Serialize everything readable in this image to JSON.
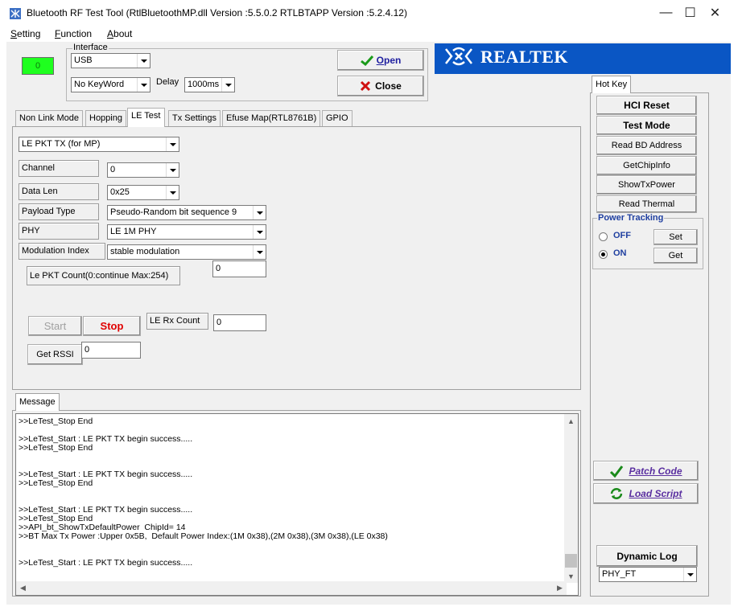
{
  "window": {
    "title": "Bluetooth RF Test Tool (RtlBluetoothMP.dll Version :5.5.0.2   RTLBTAPP Version :5.2.4.12)",
    "minimize": "—",
    "maximize": "☐",
    "close": "✕"
  },
  "menu": {
    "setting": "etting",
    "setting_key": "S",
    "function": "unction",
    "function_key": "F",
    "about": "bout",
    "about_key": "A"
  },
  "status_lamp": {
    "value": "0",
    "color": "#1fff1f"
  },
  "interface": {
    "legend": "Interface",
    "port": "USB",
    "keyword": "No KeyWord",
    "delay_label": "Delay",
    "delay_value": "1000ms"
  },
  "buttons": {
    "open": "Open",
    "open_key": "O",
    "close": "Close"
  },
  "brand": {
    "name": "REALTEK",
    "color": "#0a56c4"
  },
  "tabs": [
    {
      "label": "Non Link Mode"
    },
    {
      "label": "Hopping"
    },
    {
      "label": "LE Test",
      "active": true
    },
    {
      "label": "Tx Settings"
    },
    {
      "label": "Efuse Map(RTL8761B)"
    },
    {
      "label": "GPIO"
    }
  ],
  "le_test": {
    "mode": "LE PKT TX (for MP)",
    "channel_label": "Channel",
    "channel_value": "0",
    "datalen_label": "Data Len",
    "datalen_value": "0x25",
    "payload_label": "Payload Type",
    "payload_value": "Pseudo-Random bit sequence 9",
    "phy_label": "PHY",
    "phy_value": "LE 1M PHY",
    "modulation_label": "Modulation Index",
    "modulation_value": "stable modulation",
    "pktcount_label": "Le PKT Count(0:continue Max:254)",
    "pktcount_value": "0",
    "start": "Start",
    "stop": "Stop",
    "stop_color": "#e00000",
    "rxcount_label": "LE Rx Count",
    "rxcount_value": "0",
    "rssi_button": "Get RSSI",
    "rssi_value": "0"
  },
  "message": {
    "tab": "Message",
    "lines": [
      ">>LeTest_Stop End",
      "",
      ">>LeTest_Start : LE PKT TX begin success.....",
      ">>LeTest_Stop End",
      "",
      "",
      ">>LeTest_Start : LE PKT TX begin success.....",
      ">>LeTest_Stop End",
      "",
      "",
      ">>LeTest_Start : LE PKT TX begin success.....",
      ">>LeTest_Stop End",
      ">>API_bt_ShowTxDefaultPower  ChipId= 14",
      ">>BT Max Tx Power :Upper 0x5B,  Default Power Index:(1M 0x38),(2M 0x38),(3M 0x38),(LE 0x38)",
      "",
      "",
      ">>LeTest_Start : LE PKT TX begin success....."
    ]
  },
  "hotkey": {
    "tab": "Hot Key",
    "hci_reset": "HCI Reset",
    "test_mode": "Test Mode",
    "read_bd": "Read BD Address",
    "chip_info": "GetChipInfo",
    "show_tx": "ShowTxPower",
    "read_thermal": "Read Thermal",
    "power_tracking": {
      "legend": "Power Tracking",
      "off": "OFF",
      "on": "ON",
      "selected": "ON",
      "set": "Set",
      "get": "Get"
    },
    "patch_code": "Patch Code",
    "load_script": "Load Script",
    "dynamic_log": "Dynamic Log",
    "log_level": "PHY_FT"
  }
}
